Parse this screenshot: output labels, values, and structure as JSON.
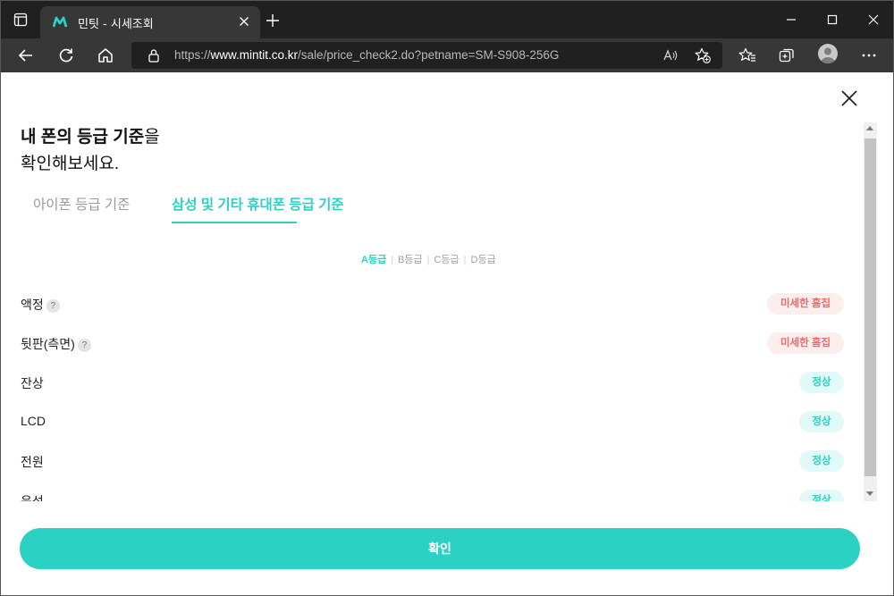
{
  "browser": {
    "tab_title": "민팃 - 시세조회",
    "url_prefix": "https://",
    "url_domain": "www.mintit.co.kr",
    "url_path": "/sale/price_check2.do?petname=SM-S908-256G"
  },
  "modal": {
    "heading_strong": "내 폰의 등급 기준",
    "heading_particle": "을",
    "heading_line2": "확인해보세요.",
    "tabs": [
      {
        "label": "아이폰 등급 기준",
        "active": false
      },
      {
        "label": "삼성 및 기타 휴대폰 등급 기준",
        "active": true
      }
    ],
    "grades": [
      {
        "label": "A등급",
        "active": true
      },
      {
        "label": "B등급",
        "active": false
      },
      {
        "label": "C등급",
        "active": false
      },
      {
        "label": "D등급",
        "active": false
      }
    ],
    "grade_separator": "|",
    "help_mark": "?",
    "rows": [
      {
        "label": "액정",
        "status": "미세한 흠집",
        "level": "warn",
        "help": true
      },
      {
        "label": "뒷판(측면)",
        "status": "미세한 흠집",
        "level": "warn",
        "help": true
      },
      {
        "label": "잔상",
        "status": "정상",
        "level": "ok",
        "help": false
      },
      {
        "label": "LCD",
        "status": "정상",
        "level": "ok",
        "help": false
      },
      {
        "label": "전원",
        "status": "정상",
        "level": "ok",
        "help": false
      },
      {
        "label": "음성",
        "status": "정상",
        "level": "ok",
        "help": false
      }
    ],
    "confirm_label": "확인"
  },
  "colors": {
    "accent": "#2bd2c4",
    "warn_text": "#ef6b6b",
    "warn_bg": "#fdeeee",
    "ok_bg": "#e2faf7"
  }
}
